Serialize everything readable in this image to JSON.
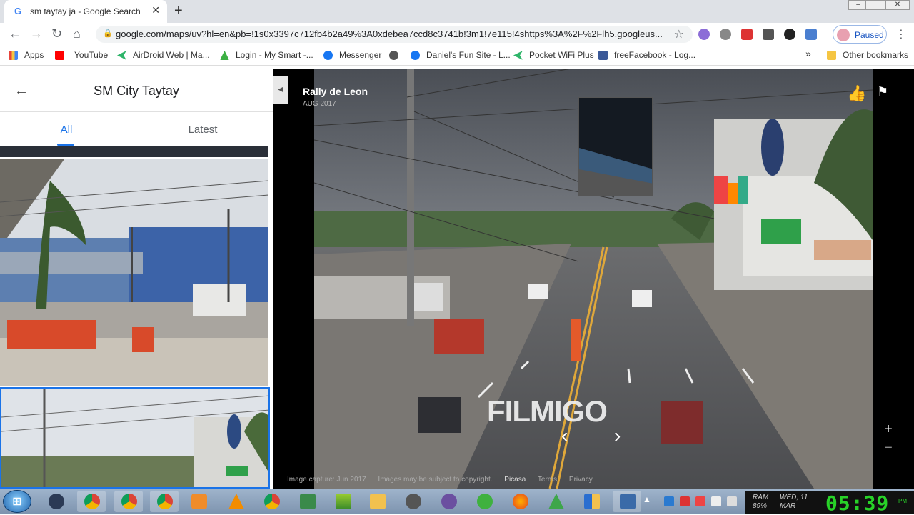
{
  "browser": {
    "tab_title": "sm taytay ja - Google Search",
    "url": "google.com/maps/uv?hl=en&pb=!1s0x3397c712fb4b2a49%3A0xdebea7ccd8c3741b!3m1!7e115!4shttps%3A%2F%2Flh5.googleus...",
    "profile_label": "Paused"
  },
  "bookmarks": [
    {
      "label": "Apps",
      "icon": "apps-grid-icon",
      "color": "#e8453c"
    },
    {
      "label": "YouTube",
      "icon": "youtube-icon",
      "color": "#ff0000"
    },
    {
      "label": "AirDroid Web | Ma...",
      "icon": "airdroid-icon",
      "color": "#2fb56a"
    },
    {
      "label": "Login - My Smart -...",
      "icon": "smart-icon",
      "color": "#3cb043"
    },
    {
      "label": "Messenger",
      "icon": "messenger-icon",
      "color": "#1877f2"
    },
    {
      "label": "Daniel's Fun Site - L...",
      "icon": "facebook-icon",
      "color": "#1877f2"
    },
    {
      "label": "Pocket WiFi Plus",
      "icon": "wifi-icon",
      "color": "#2fb56a"
    },
    {
      "label": "freeFacebook - Log...",
      "icon": "facebook-icon",
      "color": "#3b5998"
    },
    {
      "label": "Other bookmarks",
      "icon": "folder-icon",
      "color": "#f5c542"
    }
  ],
  "panel": {
    "title": "SM City Taytay",
    "tabs": [
      "All",
      "Latest"
    ]
  },
  "viewer": {
    "author": "Rally de Leon",
    "date": "AUG 2017",
    "footer": [
      "Image capture: Jun 2017",
      "Images may be subject to copyright.",
      "Picasa",
      "Terms",
      "Privacy"
    ]
  },
  "overlay": {
    "watermark": "FILMIGO"
  },
  "taskbar": {
    "ram_label": "RAM",
    "ram_value": "89%",
    "day": "WED, 11",
    "month": "MAR",
    "time": "05:39",
    "ampm": "PM"
  },
  "colors": {
    "accent": "#1a73e8",
    "clock": "#28d228"
  }
}
